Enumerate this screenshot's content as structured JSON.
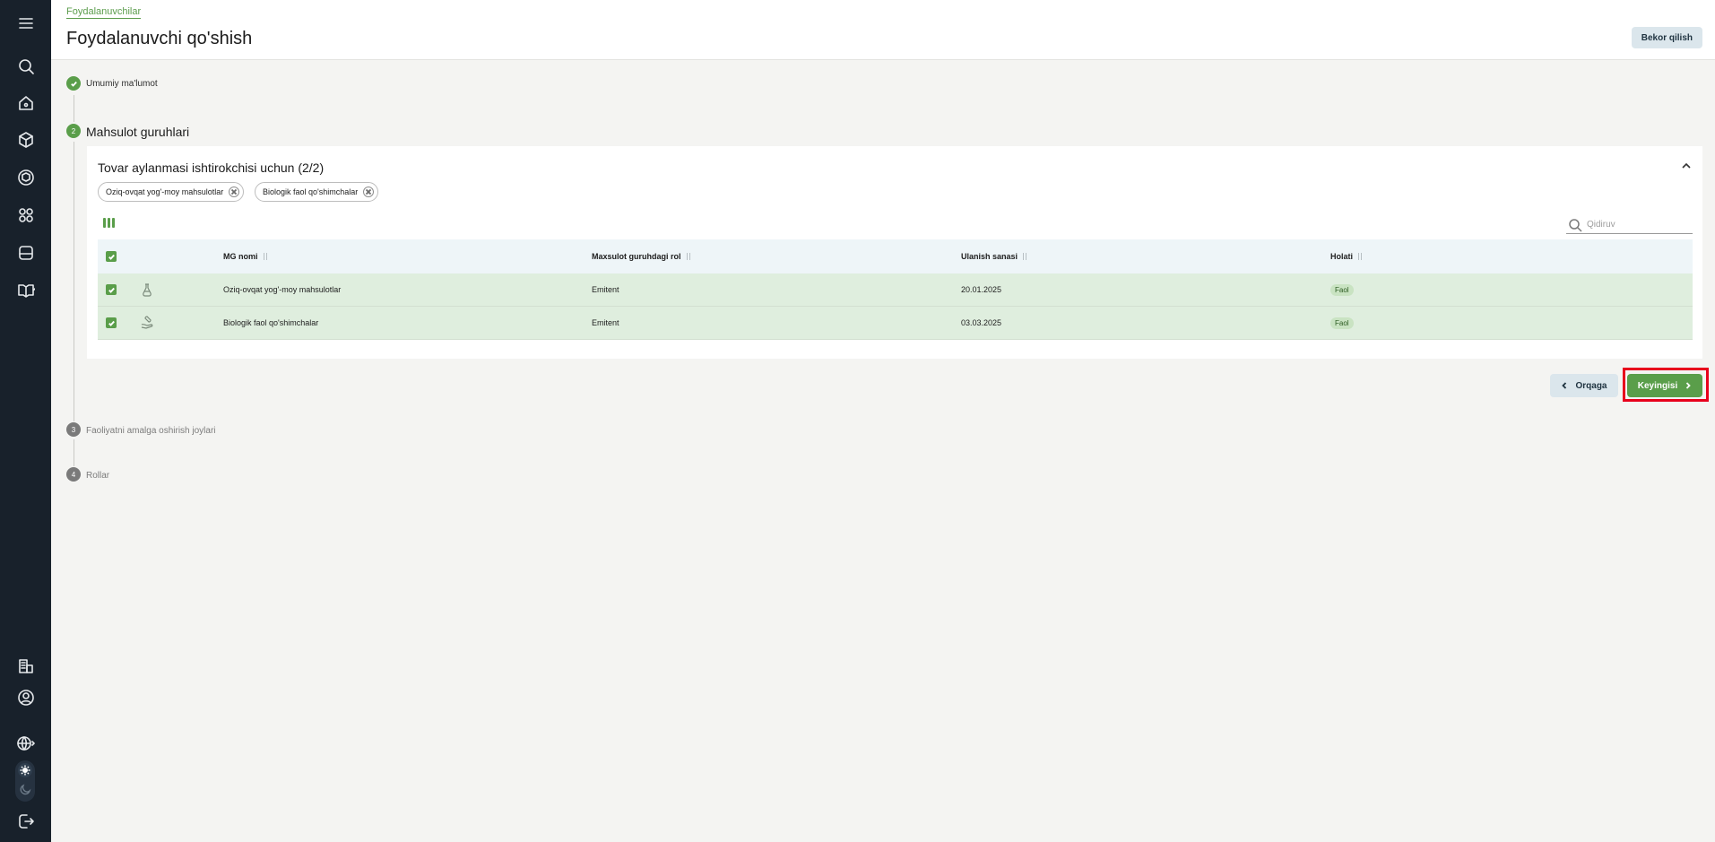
{
  "breadcrumb": "Foydalanuvchilar",
  "page_title": "Foydalanuvchi qo'shish",
  "cancel_label": "Bekor qilish",
  "steps": [
    {
      "number": "1",
      "label": "Umumiy ma'lumot",
      "state": "done"
    },
    {
      "number": "2",
      "label": "Mahsulot guruhlari",
      "state": "active"
    },
    {
      "number": "3",
      "label": "Faoliyatni amalga oshirish joylari",
      "state": "todo"
    },
    {
      "number": "4",
      "label": "Rollar",
      "state": "todo"
    }
  ],
  "card": {
    "title": "Tovar aylanmasi ishtirokchisi uchun (2/2)",
    "chips": [
      "Oziq-ovqat yog'-moy mahsulotlar",
      "Biologik faol qo'shimchalar"
    ],
    "search_placeholder": "Qidiruv",
    "columns": [
      "MG nomi",
      "Maxsulot guruhdagi rol",
      "Ulanish sanasi",
      "Holati"
    ],
    "rows": [
      {
        "name": "Oziq-ovqat yog'-moy mahsulotlar",
        "role": "Emitent",
        "date": "20.01.2025",
        "status": "Faol",
        "icon": "flask-icon",
        "checked": true
      },
      {
        "name": "Biologik faol qo'shimchalar",
        "role": "Emitent",
        "date": "03.03.2025",
        "status": "Faol",
        "icon": "capsule-hand-icon",
        "checked": true
      }
    ]
  },
  "buttons": {
    "back": "Orqaga",
    "next": "Keyingisi"
  },
  "sidebar_icons": [
    "menu-icon",
    "search-icon",
    "home-icon",
    "box-icon",
    "package-scan-icon",
    "scan-icon",
    "storage-icon",
    "book-icon",
    "building-doc-icon",
    "profile-icon",
    "globe-icon",
    "sun-icon",
    "moon-icon",
    "logout-icon"
  ],
  "colors": {
    "accent": "#5a9e4a",
    "sidebar": "#18212b",
    "highlight": "#e8001c"
  }
}
